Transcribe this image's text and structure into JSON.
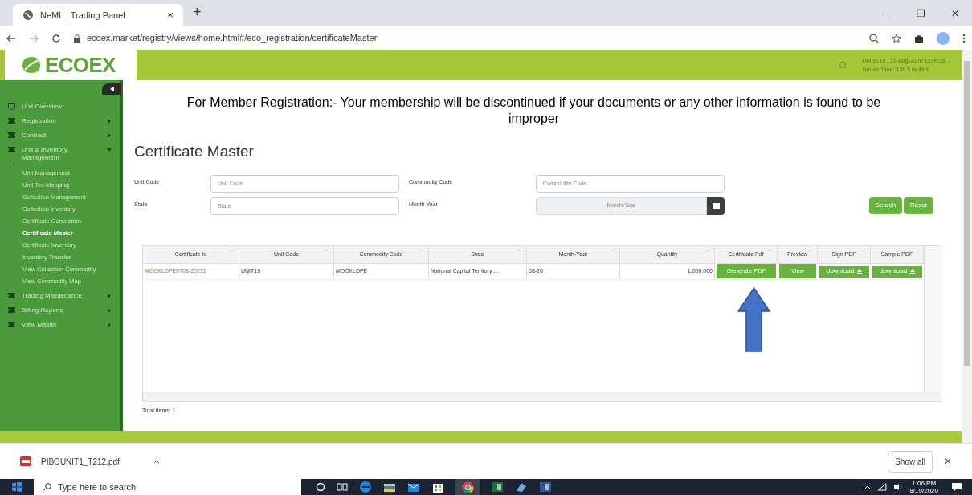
{
  "browser": {
    "tab_title": "NeML | Trading Panel",
    "tab_close": "×",
    "new_tab": "+",
    "url": "ecoex.market/registry/views/home.html#/eco_registration/certificateMaster",
    "window_controls": [
      "–",
      "❐",
      "✕"
    ]
  },
  "header": {
    "logo": "ECOEX",
    "session": "DMBC19 : 19-Aug-2020 13:00:26 -",
    "server_time": "Server Time: 13h 5 m 49 s"
  },
  "sidebar": {
    "items": [
      {
        "label": "Unit Overview",
        "kind": "link"
      },
      {
        "label": "Registration",
        "kind": "menu",
        "expanded": false
      },
      {
        "label": "Contract",
        "kind": "menu",
        "expanded": false
      },
      {
        "label": "Unit & Inventory Management",
        "kind": "menu",
        "expanded": true,
        "children": [
          {
            "label": "Unit Management",
            "selected": false
          },
          {
            "label": "Unit Tec Mapping",
            "selected": false
          },
          {
            "label": "Collection Management",
            "selected": false
          },
          {
            "label": "Collection Inventory",
            "selected": false
          },
          {
            "label": "Certificate Generation",
            "selected": false
          },
          {
            "label": "Certificate Master",
            "selected": true
          },
          {
            "label": "Certificate Inventory",
            "selected": false
          },
          {
            "label": "Inventory Transfer",
            "selected": false
          },
          {
            "label": "View Collection Commodity",
            "selected": false
          },
          {
            "label": "View Commodity Map",
            "selected": false
          }
        ]
      },
      {
        "label": "Trading Maintenance",
        "kind": "menu",
        "expanded": false
      },
      {
        "label": "Billing Reports",
        "kind": "menu",
        "expanded": false
      },
      {
        "label": "View Master",
        "kind": "menu",
        "expanded": false
      }
    ]
  },
  "notice": "For Member Registration:- Your membership will be discontinued if your documents or any other information is found to be improper",
  "page_title": "Certificate Master",
  "filters": [
    {
      "label": "Unit Code",
      "placeholder": "Unit Code",
      "disabled": false
    },
    {
      "label": "Commodity Code",
      "placeholder": "Commodity Code",
      "disabled": false
    },
    {
      "label": "State",
      "placeholder": "State",
      "disabled": false
    },
    {
      "label": "Month-Year",
      "placeholder": "Month-Year",
      "disabled": true
    }
  ],
  "buttons": [
    "Search",
    "Reset"
  ],
  "table": {
    "columns": [
      "Certificate Id",
      "Unit Code",
      "Commodity Code",
      "State",
      "Month-Year",
      "Quantity",
      "Certificate Pdf",
      "Preview",
      "Sign PDF",
      "Sample PDF"
    ],
    "rows": [
      {
        "certificate_id": "MOCKLDPE0708-20231",
        "unit_code": "UNIT19",
        "commodity_code": "MOCKLDPE",
        "state": "National Capital Territory ...",
        "month_year": "08-20",
        "quantity": "1,000.000",
        "certificate_pdf": "Generate PDF",
        "preview": "View",
        "sign_pdf": "download",
        "sample_pdf": "download"
      }
    ],
    "total": "Total Items: 1"
  },
  "downloads": {
    "file": "PIBOUNIT1_T212.pdf",
    "show_all": "Show all",
    "close": "✕"
  },
  "taskbar": {
    "search_placeholder": "Type here to search",
    "time": "1:06 PM",
    "date": "8/19/2020"
  }
}
